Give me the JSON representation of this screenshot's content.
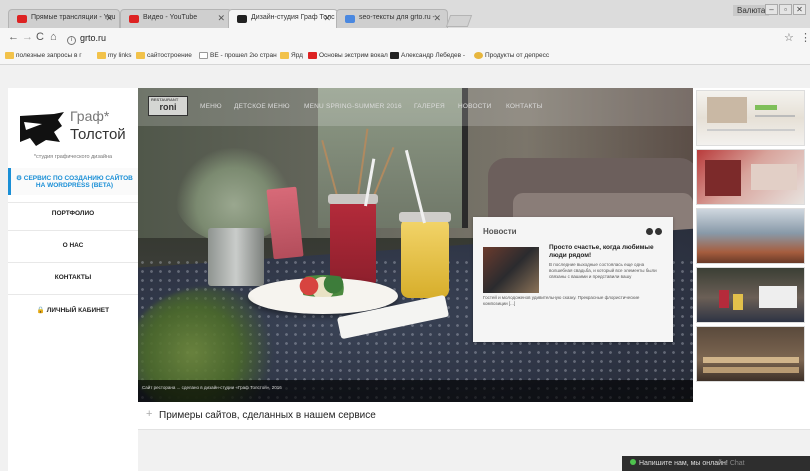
{
  "browser": {
    "tabs": [
      {
        "label": "Прямые трансляции - You",
        "favicon": "youtube-icon"
      },
      {
        "label": "Видео - YouTube",
        "favicon": "youtube-icon"
      },
      {
        "label": "Дизайн-студия Граф Толс",
        "favicon": "grafto-icon"
      },
      {
        "label": "seo-тексты для grto.ru -",
        "favicon": "doc-icon"
      }
    ],
    "window_user": "Валюта",
    "url": "grto.ru",
    "bookmarks": [
      {
        "label": "полезные запросы в г",
        "icon": "folder"
      },
      {
        "label": "my links",
        "icon": "folder"
      },
      {
        "label": "сайтостроение",
        "icon": "folder"
      },
      {
        "label": "ВЕ - прошел 2ю стран",
        "icon": "page"
      },
      {
        "label": "Ярд",
        "icon": "folder"
      },
      {
        "label": "Основы экстрим вокал",
        "icon": "youtube"
      },
      {
        "label": "Александр Лебедев -",
        "icon": "dark"
      },
      {
        "label": "Продукты от депресс",
        "icon": "gold"
      }
    ]
  },
  "site": {
    "logo_line1": "Граф*",
    "logo_line2": "Толстой",
    "tagline": "*студия графического дизайна",
    "menu": [
      {
        "label": "⚙ СЕРВИС ПО СОЗДАНИЮ САЙТОВ НА WORDPRESS (BETA)",
        "active": true
      },
      {
        "label": "ПОРТФОЛИО"
      },
      {
        "label": "О НАС"
      },
      {
        "label": "КОНТАКТЫ"
      },
      {
        "label": "🔒 ЛИЧНЫЙ КАБИНЕТ"
      }
    ],
    "hero_brand": "roni",
    "hero_brand_small": "RESTAURANT",
    "hero_nav": [
      "МЕНЮ",
      "ДЕТСКОЕ МЕНЮ",
      "MENU SPRING-SUMMER 2016",
      "ГАЛЕРЕЯ",
      "НОВОСТИ",
      "КОНТАКТЫ"
    ],
    "news": {
      "heading": "Новости",
      "title": "Просто счастье, когда любимые люди рядом!",
      "text": "В последние выходные состоялась еще одна волшебная свадьба, и который все элементы были связаны с вашими и представили вашу",
      "text2": "Гостей и молодоженов удивительную сказку. Прекрасные флористические композиции [...]"
    },
    "hero_caption": "Сайт ресторана ... сделано в дизайн-студии «Граф Толстой», 2016",
    "examples_heading": "Примеры сайтов, сделанных в нашем сервисе",
    "chat": {
      "label": "Напишите нам, мы онлайн!",
      "button": "Chat"
    }
  }
}
